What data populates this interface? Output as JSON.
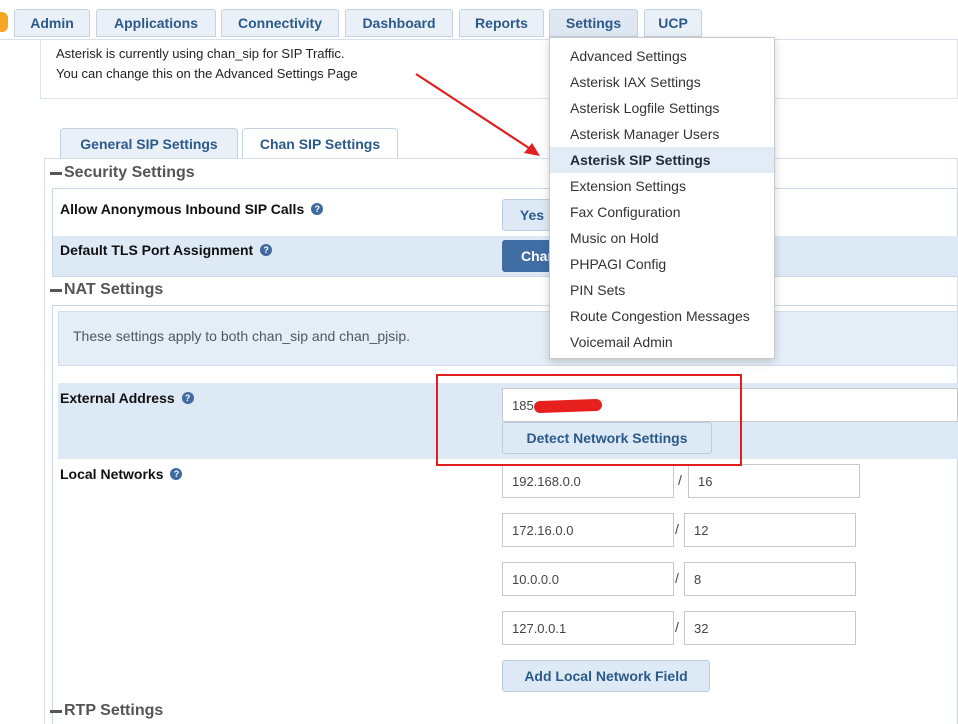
{
  "nav": {
    "tabs": [
      {
        "label": "Admin"
      },
      {
        "label": "Applications"
      },
      {
        "label": "Connectivity"
      },
      {
        "label": "Dashboard"
      },
      {
        "label": "Reports"
      },
      {
        "label": "Settings"
      },
      {
        "label": "UCP"
      }
    ],
    "active_tab": "Settings"
  },
  "notice": {
    "line1": "Asterisk is currently using chan_sip for SIP Traffic.",
    "line2": "You can change this on the Advanced Settings Page"
  },
  "subtabs": [
    {
      "label": "General SIP Settings",
      "active": true
    },
    {
      "label": "Chan SIP Settings",
      "active": false
    }
  ],
  "security": {
    "title": "Security Settings",
    "anonymous_label": "Allow Anonymous Inbound SIP Calls",
    "anonymous_value": "Yes",
    "tls_label": "Default TLS Port Assignment",
    "tls_button": "Char"
  },
  "nat": {
    "title": "NAT Settings",
    "info": "These settings apply to both chan_sip and chan_pjsip.",
    "external_address_label": "External Address",
    "external_address_value": "185",
    "detect_button": "Detect Network Settings",
    "local_networks_label": "Local Networks",
    "local_networks": [
      {
        "network": "192.168.0.0",
        "mask": "16"
      },
      {
        "network": "172.16.0.0",
        "mask": "12"
      },
      {
        "network": "10.0.0.0",
        "mask": "8"
      },
      {
        "network": "127.0.0.1",
        "mask": "32"
      }
    ],
    "add_network_button": "Add Local Network Field"
  },
  "rtp": {
    "title": "RTP Settings"
  },
  "settings_menu": {
    "items": [
      "Advanced Settings",
      "Asterisk IAX Settings",
      "Asterisk Logfile Settings",
      "Asterisk Manager Users",
      "Asterisk SIP Settings",
      "Extension Settings",
      "Fax Configuration",
      "Music on Hold",
      "PHPAGI Config",
      "PIN Sets",
      "Route Congestion Messages",
      "Voicemail Admin"
    ],
    "selected": "Asterisk SIP Settings"
  },
  "colors": {
    "accent": "#2b5a8a",
    "annotation": "#e0201f"
  }
}
